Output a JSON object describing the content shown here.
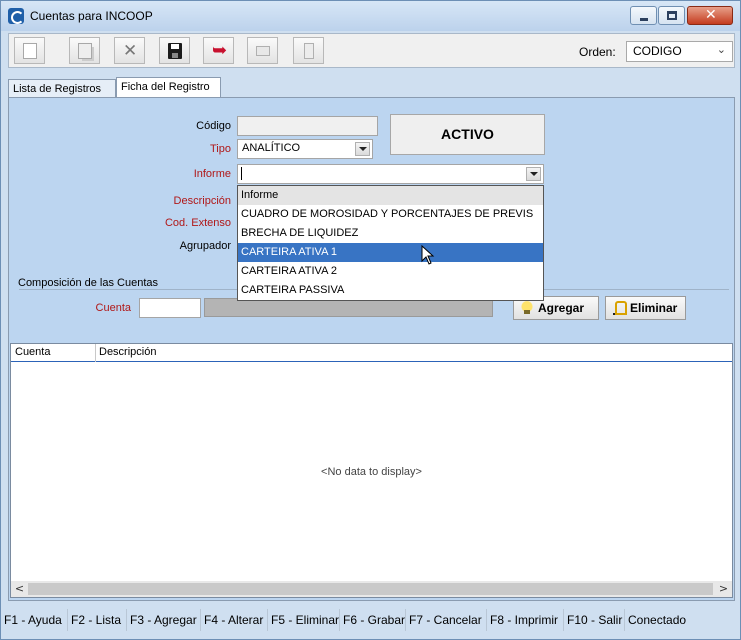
{
  "window": {
    "title": "Cuentas para INCOOP",
    "close_glyph": "✕"
  },
  "toolbar": {
    "icons": [
      "new-document-icon",
      "copy-icon",
      "delete-icon",
      "save-icon",
      "undo-icon",
      "print-icon",
      "exit-icon"
    ],
    "undo_glyph": "➥",
    "delete_glyph": "✕",
    "orden_label": "Orden:",
    "orden_value": "CODIGO"
  },
  "tabs": [
    {
      "label": "Lista de Registros",
      "active": false
    },
    {
      "label": "Ficha del Registro",
      "active": true
    }
  ],
  "form": {
    "codigo_label": "Código",
    "codigo_value": "",
    "tipo_label": "Tipo",
    "tipo_value": "ANALÍTICO",
    "informe_label": "Informe",
    "informe_value": "",
    "descripcion_label": "Descripción",
    "cod_extenso_label": "Cod. Extenso",
    "agrupador_label": "Agrupador",
    "status_badge": "ACTIVO"
  },
  "informe_dropdown": {
    "header": "Informe",
    "options": [
      "CUADRO DE MOROSIDAD Y PORCENTAJES DE PREVIS",
      "BRECHA DE LIQUIDEZ",
      "CARTEIRA ATIVA 1",
      "CARTEIRA ATIVA 2",
      "CARTEIRA PASSIVA"
    ],
    "highlighted": "CARTEIRA ATIVA 1"
  },
  "composicion": {
    "title": "Composición de las Cuentas",
    "cuenta_label": "Cuenta",
    "agregar_label": "Agregar",
    "eliminar_label": "Eliminar"
  },
  "grid": {
    "columns": [
      "Cuenta",
      "Descripción"
    ],
    "empty_text": "<No data to display>",
    "scroll_left": "<",
    "scroll_right": ">"
  },
  "statusbar": [
    "F1 - Ayuda",
    "F2 - Lista",
    "F3 - Agregar",
    "F4 - Alterar",
    "F5 - Eliminar",
    "F6 - Grabar",
    "F7 - Cancelar",
    "F8 - Imprimir",
    "F10 - Salir",
    "Conectado"
  ],
  "colors": {
    "panel_bg": "#bcd5f0",
    "required_label": "#b01818",
    "selection": "#3874c4",
    "grid_header_line": "#2c63b8"
  }
}
